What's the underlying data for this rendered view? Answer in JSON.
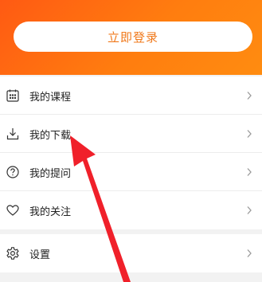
{
  "header": {
    "login_label": "立即登录"
  },
  "menu": {
    "items": [
      {
        "label": "我的课程",
        "icon": "calendar-icon"
      },
      {
        "label": "我的下载",
        "icon": "download-icon"
      },
      {
        "label": "我的提问",
        "icon": "question-icon"
      },
      {
        "label": "我的关注",
        "icon": "heart-icon"
      }
    ],
    "settings": {
      "label": "设置",
      "icon": "gear-icon"
    }
  },
  "colors": {
    "header_gradient_start": "#ff5a13",
    "header_gradient_end": "#ff8c10",
    "login_text": "#f0781a",
    "annotation_arrow": "#f0202a"
  }
}
